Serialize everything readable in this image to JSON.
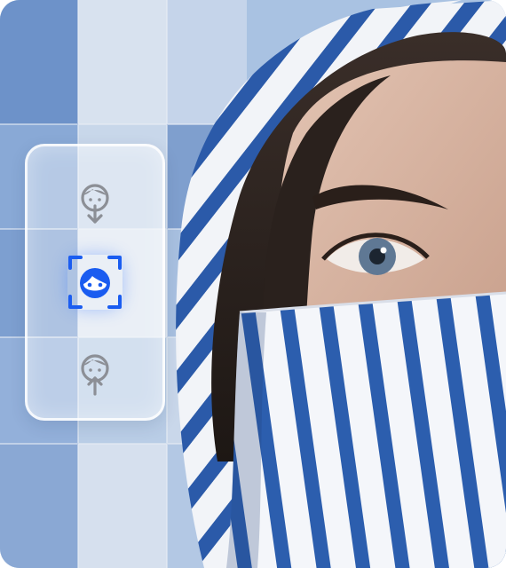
{
  "colors": {
    "accent": "#1a5cf0",
    "icon_inactive": "#8c8f96",
    "panel_border": "#ffffff",
    "stripe_blue": "#2a5aa8",
    "wall_blue": "#5f86c2",
    "hair": "#2a211d",
    "skin": "#d9b9a7"
  },
  "panel": {
    "buttons": [
      {
        "icon": "face-download-icon",
        "state": "inactive"
      },
      {
        "icon": "face-scan-icon",
        "state": "active"
      },
      {
        "icon": "face-upload-icon",
        "state": "inactive"
      }
    ]
  }
}
